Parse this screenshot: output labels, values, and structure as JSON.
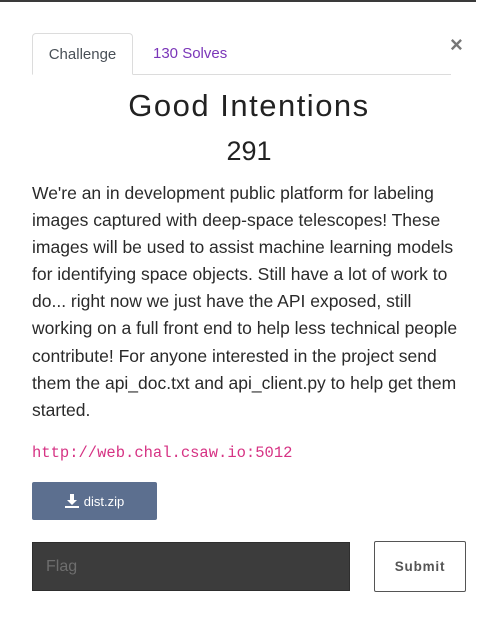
{
  "tabs": [
    {
      "label": "Challenge",
      "active": true
    },
    {
      "label": "130 Solves",
      "active": false
    }
  ],
  "close_icon": "×",
  "challenge": {
    "title": "Good Intentions",
    "points": "291",
    "description": "We're an in development public platform for labeling images captured with deep-space telescopes! These images will be used to assist machine learning models for identifying space objects. Still have a lot of work to do... right now we just have the API exposed, still working on a full front end to help less technical people contribute! For anyone interested in the project send them the api_doc.txt and api_client.py to help get them started.",
    "link": "http://web.chal.csaw.io:5012",
    "download_label": "dist.zip",
    "download_icon": "download-icon"
  },
  "flag": {
    "placeholder": "Flag",
    "value": ""
  },
  "submit_label": "Submit",
  "colors": {
    "tab_solves": "#7a35b8",
    "link": "#d63384",
    "download_button": "#5c6f8f",
    "flag_input_bg": "#3c3c3c"
  }
}
